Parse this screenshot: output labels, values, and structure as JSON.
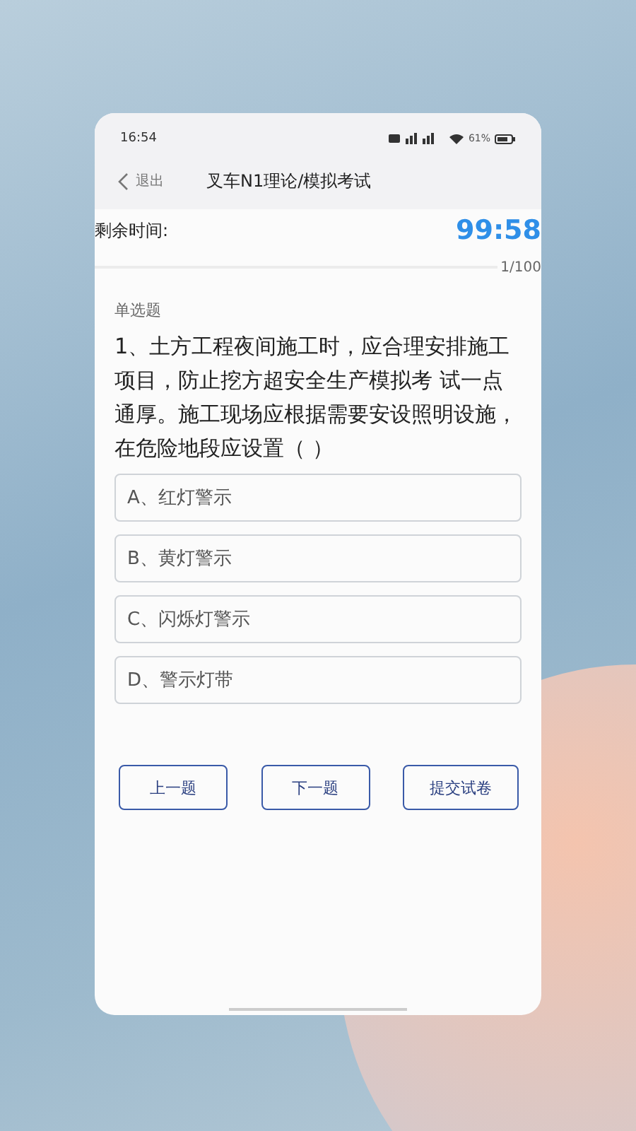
{
  "status_bar": {
    "time": "16:54",
    "battery_text": "61%"
  },
  "header": {
    "back_label": "退出",
    "title": "叉车N1理论/模拟考试"
  },
  "timer": {
    "label": "剩余时间:",
    "value": "99:58"
  },
  "progress": {
    "text": "1/100"
  },
  "question": {
    "type_label": "单选题",
    "text": "1、土方工程夜间施工时，应合理安排施工项目，防止挖方超安全生产模拟考 试一点通厚。施工现场应根据需要安设照明设施，在危险地段应设置（ ）"
  },
  "options": [
    {
      "label": "A、红灯警示",
      "selected": false
    },
    {
      "label": "B、黄灯警示",
      "selected": false
    },
    {
      "label": "C、闪烁灯警示",
      "selected": false
    },
    {
      "label": "D、警示灯带",
      "selected": false
    }
  ],
  "buttons": [
    "上一题",
    "下一题",
    "提交试卷"
  ]
}
